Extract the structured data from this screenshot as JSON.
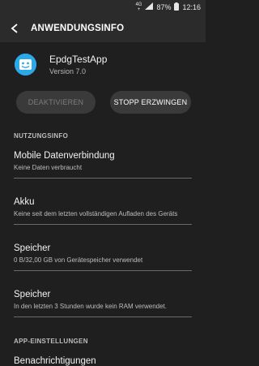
{
  "status_bar": {
    "network": "4G",
    "network_sub": "+",
    "battery": "87%",
    "time": "12:16"
  },
  "app_bar": {
    "title": "ANWENDUNGSINFO",
    "back_icon": "arrow-left-icon"
  },
  "app": {
    "name": "EpdgTestApp",
    "version": "Version 7.0",
    "icon_color": "#2aa8e8"
  },
  "buttons": {
    "disable_label": "DEAKTIVIEREN",
    "force_stop_label": "STOPP ERZWINGEN"
  },
  "sections": {
    "usage": "NUTZUNGSINFO",
    "app_settings": "APP-EINSTELLUNGEN"
  },
  "items": [
    {
      "title": "Mobile Datenverbindung",
      "subtitle": "Keine Daten verbraucht"
    },
    {
      "title": "Akku",
      "subtitle": "Keine seit dem letzten vollständigen Aufladen des Geräts"
    },
    {
      "title": "Speicher",
      "subtitle": "0 B/32,00 GB von Gerätespeicher verwendet"
    },
    {
      "title": "Speicher",
      "subtitle": "In den letzten 3 Stunden wurde kein RAM verwendet."
    },
    {
      "title": "Benachrichtigungen"
    }
  ],
  "colors": {
    "background": "#1f1f1f",
    "bar": "#2b2b2b",
    "button": "#3a3a3a",
    "divider": "#6a6a6a"
  }
}
